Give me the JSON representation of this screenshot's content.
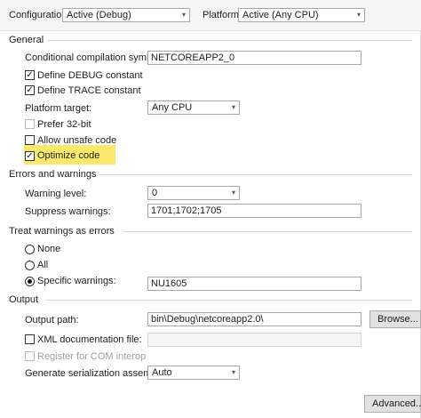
{
  "toolbar": {
    "configuration_label": "Configuration:",
    "configuration_value": "Active (Debug)",
    "platform_label": "Platform:",
    "platform_value": "Active (Any CPU)"
  },
  "general": {
    "title": "General",
    "conditional_symbols_label": "Conditional compilation symbols:",
    "conditional_symbols_value": "NETCOREAPP2_0",
    "define_debug_label": "Define DEBUG constant",
    "define_debug_checked": true,
    "define_trace_label": "Define TRACE constant",
    "define_trace_checked": true,
    "platform_target_label": "Platform target:",
    "platform_target_value": "Any CPU",
    "prefer32_label": "Prefer 32-bit",
    "prefer32_checked": false,
    "unsafe_label": "Allow unsafe code",
    "unsafe_checked": false,
    "optimize_label": "Optimize code",
    "optimize_checked": true,
    "highlight_color": "#fae96b"
  },
  "errors": {
    "title": "Errors and warnings",
    "warning_level_label": "Warning level:",
    "warning_level_value": "0",
    "suppress_label": "Suppress warnings:",
    "suppress_value": "1701;1702;1705"
  },
  "treat": {
    "title": "Treat warnings as errors",
    "none_label": "None",
    "all_label": "All",
    "specific_label": "Specific warnings:",
    "specific_value": "NU1605",
    "selected": "specific"
  },
  "output": {
    "title": "Output",
    "path_label": "Output path:",
    "path_value": "bin\\Debug\\netcoreapp2.0\\",
    "browse_label": "Browse...",
    "xml_label": "XML documentation file:",
    "xml_value": "",
    "register_com_label": "Register for COM interop",
    "serialization_label": "Generate serialization assembly:",
    "serialization_value": "Auto"
  },
  "advanced_label": "Advanced...",
  "icons": {
    "checked": "✓",
    "dropdown": "▾"
  }
}
